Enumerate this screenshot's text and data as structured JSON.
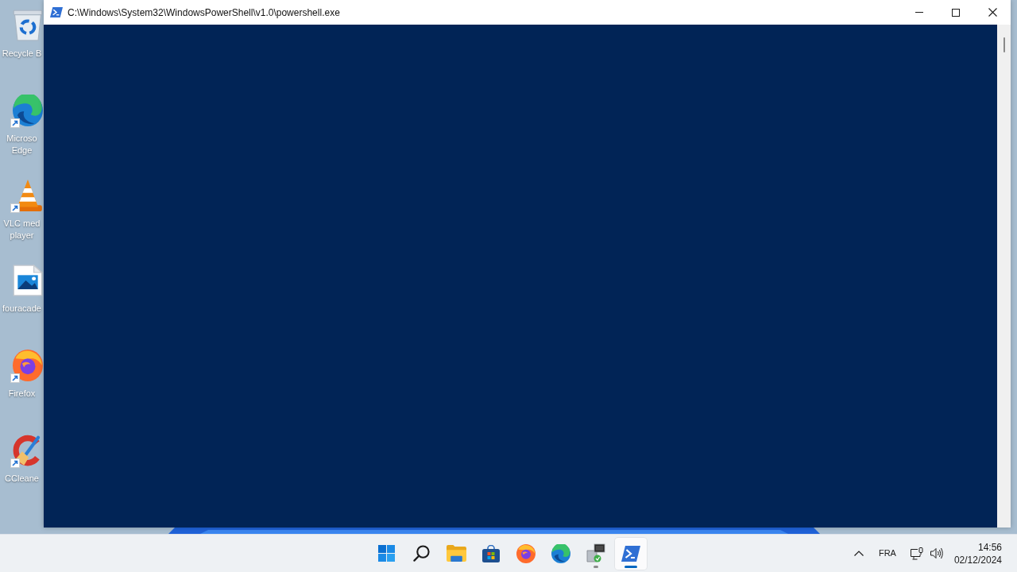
{
  "desktop": {
    "icons": [
      {
        "kind": "recycle-bin",
        "label": "Recycle B",
        "shortcut": false
      },
      {
        "kind": "edge",
        "label": "Microso Edge",
        "shortcut": true
      },
      {
        "kind": "vlc",
        "label": "VLC med player",
        "shortcut": true
      },
      {
        "kind": "image-file",
        "label": "fouracade",
        "shortcut": false
      },
      {
        "kind": "firefox",
        "label": "Firefox",
        "shortcut": true
      },
      {
        "kind": "ccleaner",
        "label": "CCleane",
        "shortcut": true
      }
    ]
  },
  "window": {
    "title": "C:\\Windows\\System32\\WindowsPowerShell\\v1.0\\powershell.exe"
  },
  "taskbar": {
    "apps": [
      {
        "kind": "start",
        "selected": false,
        "running": false
      },
      {
        "kind": "search",
        "selected": false,
        "running": false
      },
      {
        "kind": "file-explorer",
        "selected": false,
        "running": false
      },
      {
        "kind": "store",
        "selected": false,
        "running": false
      },
      {
        "kind": "firefox",
        "selected": false,
        "running": false
      },
      {
        "kind": "edge",
        "selected": false,
        "running": false
      },
      {
        "kind": "setup",
        "selected": false,
        "running": true
      },
      {
        "kind": "powershell",
        "selected": true,
        "running": true
      }
    ],
    "tray": {
      "language": "FRA",
      "time": "14:56",
      "date": "02/12/2024"
    }
  }
}
